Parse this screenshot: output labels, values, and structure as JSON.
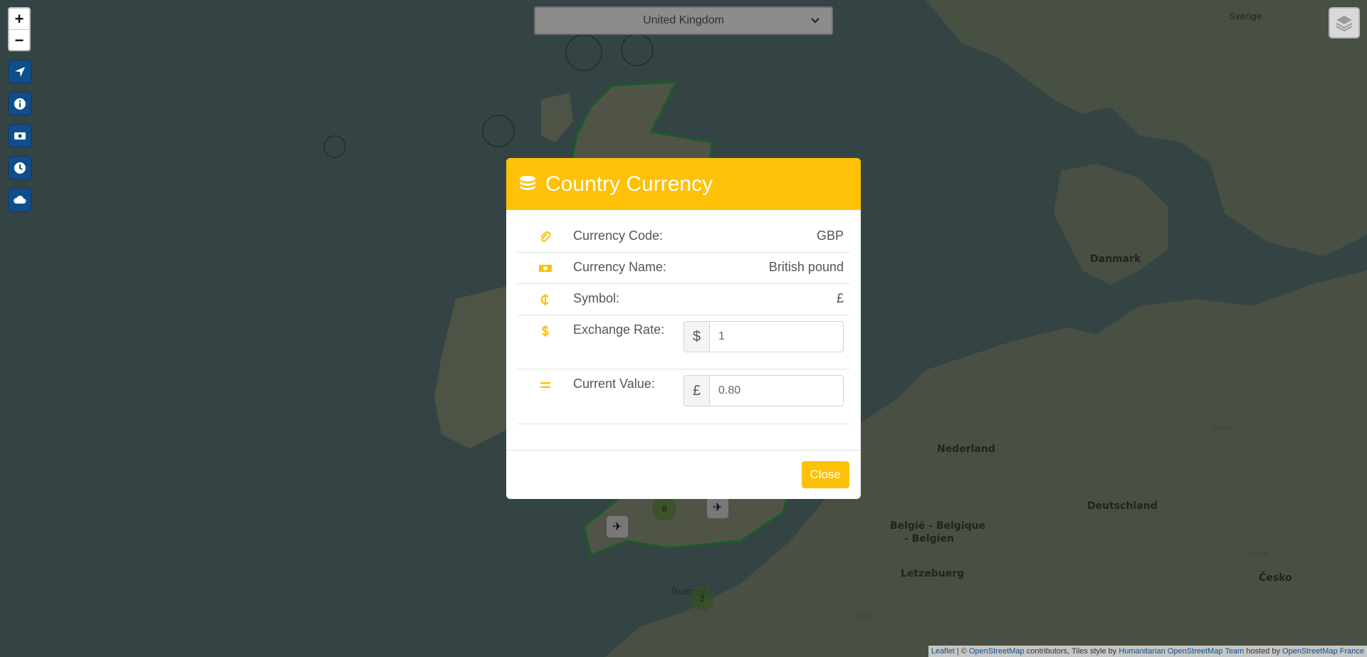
{
  "country_select": {
    "value": "United Kingdom"
  },
  "zoom": {
    "in_label": "+",
    "out_label": "−"
  },
  "map_labels": [
    {
      "text": "Sverige",
      "cls": "mid"
    },
    {
      "text": "Danmark",
      "cls": "big"
    },
    {
      "text": "København",
      "cls": "small"
    },
    {
      "text": "Nederland",
      "cls": "big"
    },
    {
      "text": "Deutschland",
      "cls": "big"
    },
    {
      "text": "Berlin",
      "cls": "small"
    },
    {
      "text": "België - Belgique",
      "cls": "big"
    },
    {
      "text": "- Belgien",
      "cls": "big"
    },
    {
      "text": "Letzebuerg",
      "cls": "big"
    },
    {
      "text": "Praha",
      "cls": "small"
    },
    {
      "text": "Česko",
      "cls": "big"
    },
    {
      "text": "Paris",
      "cls": "small"
    },
    {
      "text": "Guernsey",
      "cls": "mid"
    }
  ],
  "clusters": [
    "8",
    "2"
  ],
  "modal": {
    "title": "Country Currency",
    "rows": {
      "code": {
        "label": "Currency Code:",
        "value": "GBP"
      },
      "name": {
        "label": "Currency Name:",
        "value": "British pound"
      },
      "symbol": {
        "label": "Symbol:",
        "value": "£"
      },
      "rate": {
        "label": "Exchange Rate:",
        "prefix": "$",
        "value": "1"
      },
      "current": {
        "label": "Current Value:",
        "prefix": "£",
        "value": "0.80"
      }
    },
    "close_label": "Close"
  },
  "attribution": {
    "leaflet": "Leaflet",
    "sep1": " | © ",
    "osm": "OpenStreetMap",
    "mid": " contributors, Tiles style by ",
    "hot": "Humanitarian OpenStreetMap Team",
    "hosted": " hosted by ",
    "osmfr": "OpenStreetMap France"
  },
  "colors": {
    "accent": "#fec107",
    "control_blue": "#0d4f8c",
    "sea": "#5b7576"
  }
}
